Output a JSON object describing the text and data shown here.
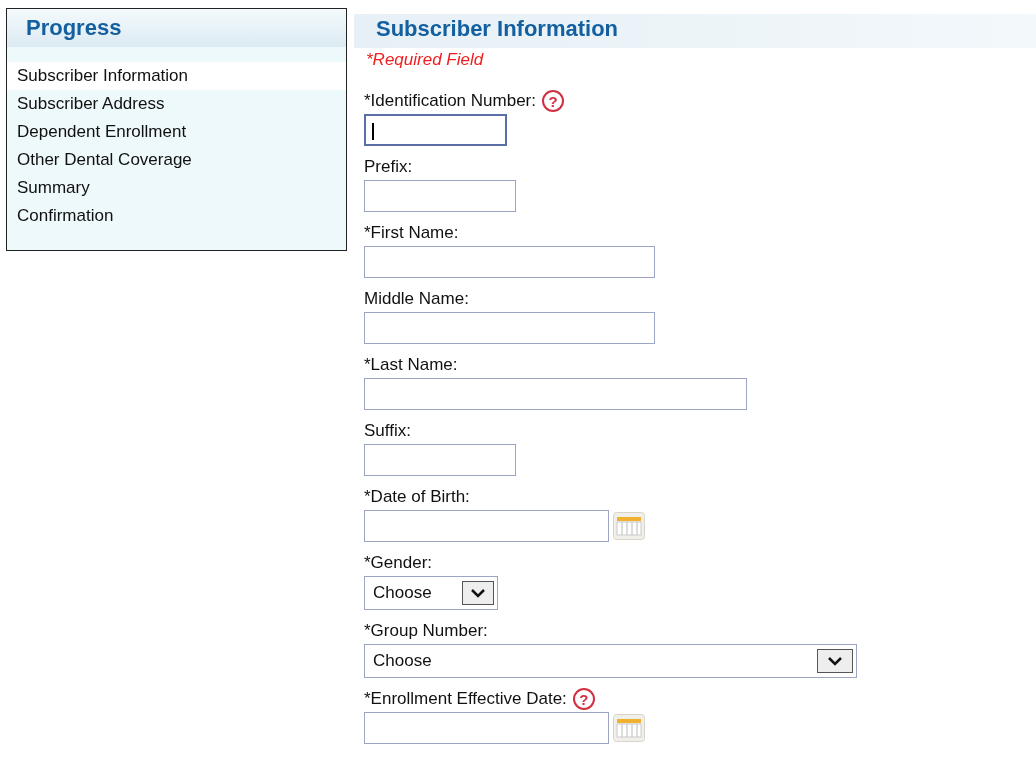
{
  "progress": {
    "title": "Progress",
    "items": [
      {
        "label": "Subscriber Information",
        "selected": true
      },
      {
        "label": "Subscriber Address",
        "selected": false
      },
      {
        "label": "Dependent Enrollment",
        "selected": false
      },
      {
        "label": "Other Dental Coverage",
        "selected": false
      },
      {
        "label": "Summary",
        "selected": false
      },
      {
        "label": "Confirmation",
        "selected": false
      }
    ]
  },
  "form": {
    "title": "Subscriber Information",
    "required_note": "*Required Field",
    "fields": [
      {
        "kind": "text",
        "label": "*Identification Number:",
        "help": "?",
        "focused": true
      },
      {
        "kind": "text",
        "label": "Prefix:",
        "focused": false
      },
      {
        "kind": "text",
        "label": "*First Name:",
        "focused": false
      },
      {
        "kind": "text",
        "label": "Middle Name:",
        "focused": false
      },
      {
        "kind": "text",
        "label": "*Last Name:",
        "focused": false
      },
      {
        "kind": "text",
        "label": "Suffix:",
        "focused": false
      },
      {
        "kind": "date",
        "label": "*Date of Birth:",
        "focused": false
      },
      {
        "kind": "select",
        "label": "*Gender:",
        "value": "Choose",
        "focused": false
      },
      {
        "kind": "select",
        "label": "*Group Number:",
        "value": "Choose",
        "focused": false
      },
      {
        "kind": "date",
        "label": "*Enrollment Effective Date:",
        "help": "?",
        "focused": false
      }
    ]
  }
}
